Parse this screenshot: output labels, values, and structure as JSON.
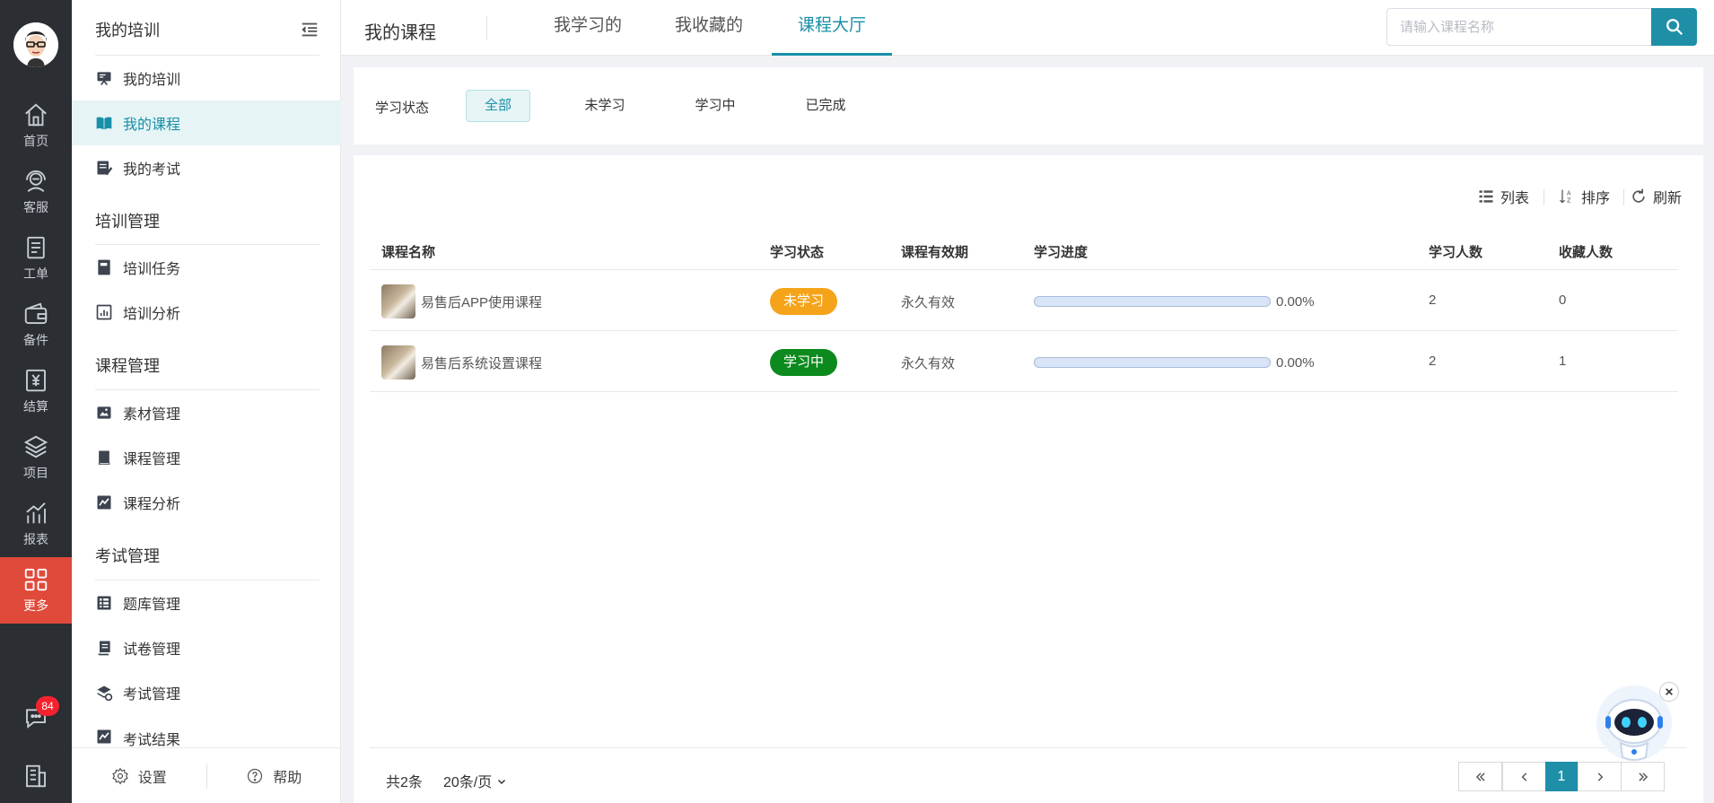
{
  "rail": {
    "items": [
      {
        "label": "首页",
        "icon": "home-icon"
      },
      {
        "label": "客服",
        "icon": "headset-icon"
      },
      {
        "label": "工单",
        "icon": "clipboard-icon"
      },
      {
        "label": "备件",
        "icon": "wallet-icon"
      },
      {
        "label": "结算",
        "icon": "yen-icon"
      },
      {
        "label": "项目",
        "icon": "layers-icon"
      },
      {
        "label": "报表",
        "icon": "chart-icon"
      },
      {
        "label": "更多",
        "icon": "grid-icon"
      }
    ],
    "message_badge": "84"
  },
  "side": {
    "header": "我的培训",
    "top_items": [
      {
        "label": "我的培训"
      },
      {
        "label": "我的课程"
      },
      {
        "label": "我的考试"
      }
    ],
    "groups": [
      {
        "title": "培训管理",
        "items": [
          {
            "label": "培训任务"
          },
          {
            "label": "培训分析"
          }
        ]
      },
      {
        "title": "课程管理",
        "items": [
          {
            "label": "素材管理"
          },
          {
            "label": "课程管理"
          },
          {
            "label": "课程分析"
          }
        ]
      },
      {
        "title": "考试管理",
        "items": [
          {
            "label": "题库管理"
          },
          {
            "label": "试卷管理"
          },
          {
            "label": "考试管理"
          },
          {
            "label": "考试结果"
          }
        ]
      }
    ],
    "footer": {
      "settings": "设置",
      "help": "帮助"
    }
  },
  "topbar": {
    "title": "我的课程",
    "tabs": [
      {
        "label": "我学习的"
      },
      {
        "label": "我收藏的"
      },
      {
        "label": "课程大厅"
      }
    ],
    "search_placeholder": "请输入课程名称"
  },
  "filter": {
    "label": "学习状态",
    "options": [
      "全部",
      "未学习",
      "学习中",
      "已完成"
    ],
    "selected": "全部"
  },
  "toolbar": {
    "list": "列表",
    "sort": "排序",
    "refresh": "刷新"
  },
  "table": {
    "columns": [
      "课程名称",
      "学习状态",
      "课程有效期",
      "学习进度",
      "学习人数",
      "收藏人数"
    ],
    "rows": [
      {
        "name": "易售后APP使用课程",
        "status": "未学习",
        "status_color": "#f5a41a",
        "validity": "永久有效",
        "progress": 0,
        "progress_text": "0.00%",
        "learners": "2",
        "favorites": "0"
      },
      {
        "name": "易售后系统设置课程",
        "status": "学习中",
        "status_color": "#0c8a1e",
        "validity": "永久有效",
        "progress": 0,
        "progress_text": "0.00%",
        "learners": "2",
        "favorites": "1"
      }
    ]
  },
  "pager": {
    "total": "共2条",
    "page_size": "20条/页",
    "current_page": "1"
  },
  "colors": {
    "accent": "#1f8fa8",
    "rail_bg": "#2b2e33",
    "rail_active": "#e04a3b"
  }
}
